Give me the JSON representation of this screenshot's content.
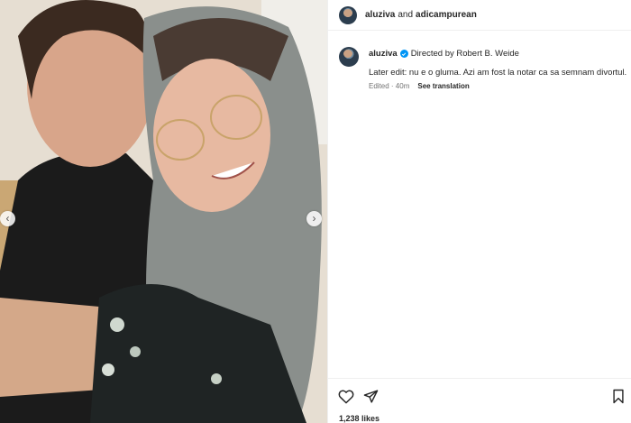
{
  "header": {
    "username": "aluziva",
    "connector": "and",
    "collaborator": "adicampurean"
  },
  "caption": {
    "username": "aluziva",
    "credit": "Directed by Robert B. Weide",
    "text": "Later edit: nu e o gluma. Azi am fost la notar ca sa semnam divortul.",
    "edited": "Edited · 40m",
    "translate_label": "See translation"
  },
  "actions": {
    "likes": "1,238 likes"
  },
  "carousel": {
    "prev_glyph": "‹",
    "next_glyph": "›"
  },
  "colors": {
    "verified": "#0095f6",
    "muted_text": "#737373",
    "divider": "#efefef"
  },
  "icons": [
    "heart-icon",
    "share-icon",
    "bookmark-icon",
    "verified-badge-icon",
    "chevron-left-icon",
    "chevron-right-icon"
  ]
}
